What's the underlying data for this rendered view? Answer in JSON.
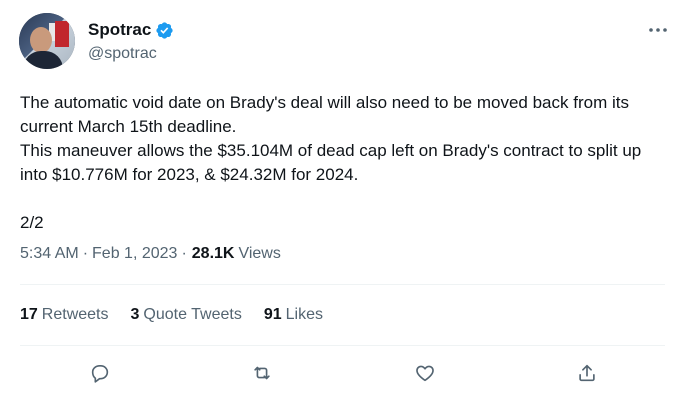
{
  "author": {
    "name": "Spotrac",
    "handle": "@spotrac",
    "verified": true
  },
  "tweet": {
    "text": "The automatic void date on Brady's deal will also need to be moved back from its current March 15th deadline.\nThis maneuver allows the $35.104M of dead cap left on Brady's contract to split up into $10.776M for 2023, & $24.32M for 2024.\n\n2/2",
    "time": "5:34 AM",
    "date": "Feb 1, 2023",
    "separator": "·",
    "views_count": "28.1K",
    "views_label": "Views"
  },
  "stats": {
    "retweets_count": "17",
    "retweets_label": "Retweets",
    "quotes_count": "3",
    "quotes_label": "Quote Tweets",
    "likes_count": "91",
    "likes_label": "Likes"
  },
  "icons": {
    "more": "more-horizontal-icon",
    "verified": "verified-badge-icon",
    "reply": "reply-icon",
    "retweet": "retweet-icon",
    "like": "heart-icon",
    "share": "share-icon"
  },
  "colors": {
    "text_primary": "#0f1419",
    "text_secondary": "#536471",
    "verified_blue": "#1d9bf0",
    "divider": "#eff3f4"
  }
}
